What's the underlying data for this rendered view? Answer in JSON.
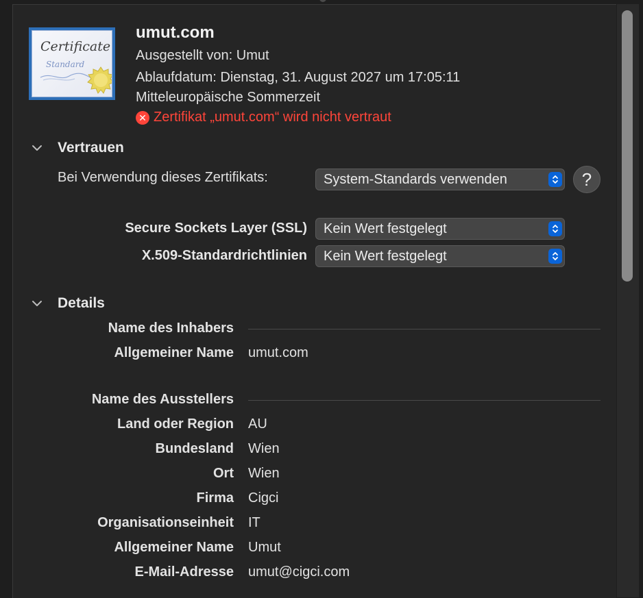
{
  "certificate": {
    "icon_text": "Certificate",
    "icon_subtext": "Standard",
    "name": "umut.com",
    "issued_by": "Ausgestellt von: Umut",
    "expiry_line1": "Ablaufdatum: Dienstag, 31. August 2027 um 17:05:11",
    "expiry_line2": "Mitteleuropäische Sommerzeit",
    "trust_status": "Zertifikat „umut.com“ wird nicht vertraut",
    "trust_status_icon": "error-x-icon"
  },
  "trust": {
    "section_title": "Vertrauen",
    "usage_label": "Bei Verwendung dieses Zertifikats:",
    "usage_value": "System-Standards verwenden",
    "help_label": "?",
    "policies": [
      {
        "label": "Secure Sockets Layer (SSL)",
        "value": "Kein Wert festgelegt"
      },
      {
        "label": "X.509-Standardrichtlinien",
        "value": "Kein Wert festgelegt"
      }
    ]
  },
  "details": {
    "section_title": "Details",
    "subject_group": "Name des Inhabers",
    "subject_rows": [
      {
        "label": "Allgemeiner Name",
        "value": "umut.com"
      }
    ],
    "issuer_group": "Name des Ausstellers",
    "issuer_rows": [
      {
        "label": "Land oder Region",
        "value": "AU"
      },
      {
        "label": "Bundesland",
        "value": "Wien"
      },
      {
        "label": "Ort",
        "value": "Wien"
      },
      {
        "label": "Firma",
        "value": "Cigci"
      },
      {
        "label": "Organisationseinheit",
        "value": "IT"
      },
      {
        "label": "Allgemeiner Name",
        "value": "Umut"
      },
      {
        "label": "E-Mail-Adresse",
        "value": "umut@cigci.com"
      }
    ]
  },
  "colors": {
    "error": "#ff453a",
    "accent": "#0a64d8",
    "background": "#252525"
  }
}
